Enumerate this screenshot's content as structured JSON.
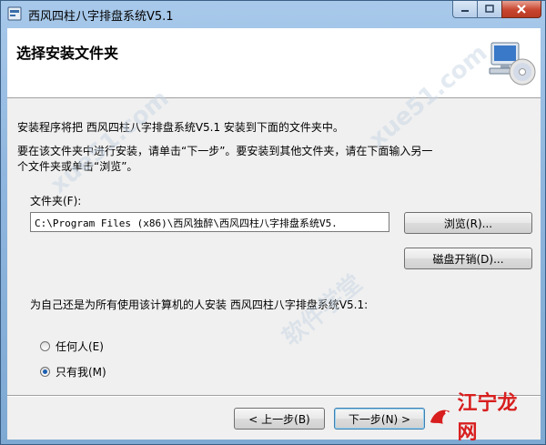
{
  "window": {
    "title": "西风四柱八字排盘系统V5.1"
  },
  "header": {
    "title": "选择安装文件夹"
  },
  "body": {
    "line1": "安装程序将把 西风四柱八字排盘系统V5.1 安装到下面的文件夹中。",
    "line2a": "要在该文件夹中进行安装，请单击“下一步”。要安装到其他文件夹，请在下面输入另一",
    "line2b": "个文件夹或单击“浏览”。",
    "folder_label": "文件夹(F):",
    "folder_value": "C:\\Program Files (x86)\\西风独醉\\西风四柱八字排盘系统V5.",
    "browse_button": "浏览(R)...",
    "disk_cost_button": "磁盘开销(D)...",
    "install_for_label": "为自己还是为所有使用该计算机的人安装 西风四柱八字排盘系统V5.1:",
    "radio_options": [
      {
        "label": "任何人(E)",
        "checked": false
      },
      {
        "label": "只有我(M)",
        "checked": true
      }
    ]
  },
  "footer": {
    "back_button": "< 上一步(B)",
    "next_button": "下一步(N) >"
  },
  "watermark": {
    "text1": "xue51.com",
    "text2": "软件学堂"
  },
  "logo": {
    "text": "江宁龙网"
  },
  "colors": {
    "title_bar": "#8fb6de",
    "close_button": "#c8452f",
    "dialog_bg": "#f0f0f0",
    "logo_red": "#d81e1e"
  }
}
